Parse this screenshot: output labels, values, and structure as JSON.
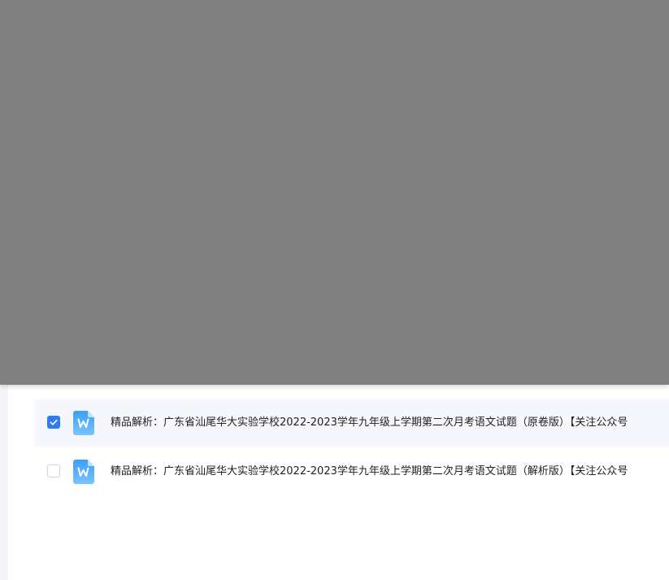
{
  "colors": {
    "overlay": "#808080",
    "selected_row_bg": "#f5f7fc",
    "checkbox_checked": "#2f7bf5",
    "word_icon_top": "#3aa0f7",
    "word_icon_bottom": "#7cc3ff"
  },
  "files": [
    {
      "name": "精品解析：广东省汕尾华大实验学校2022-2023学年九年级上学期第二次月考语文试题（原卷版）【关注公众号",
      "checked": true,
      "icon": "word-doc-icon"
    },
    {
      "name": "精品解析：广东省汕尾华大实验学校2022-2023学年九年级上学期第二次月考语文试题（解析版）【关注公众号",
      "checked": false,
      "icon": "word-doc-icon"
    }
  ]
}
